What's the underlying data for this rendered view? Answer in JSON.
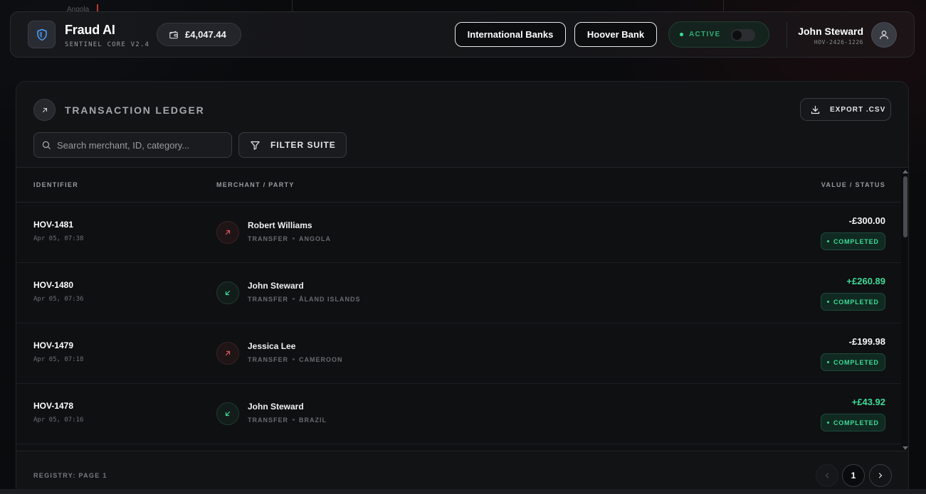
{
  "background": {
    "faint_label": "Angola"
  },
  "header": {
    "app_title": "Fraud AI",
    "app_subtitle": "SENTINEL CORE V2.4",
    "balance": "£4,047.44",
    "buttons": [
      "International Banks",
      "Hoover Bank"
    ],
    "status": "ACTIVE",
    "user_name": "John Steward",
    "user_id": "HOV-2426-1226"
  },
  "ledger": {
    "title": "TRANSACTION LEDGER",
    "export_label": "EXPORT .CSV",
    "search_placeholder": "Search merchant, ID, category...",
    "filter_label": "FILTER SUITE",
    "columns": {
      "identifier": "IDENTIFIER",
      "party": "MERCHANT / PARTY",
      "value": "VALUE / STATUS"
    },
    "rows": [
      {
        "id": "HOV-1481",
        "time": "Apr 05, 07:38",
        "party": "Robert Williams",
        "type": "TRANSFER",
        "location": "ANGOLA",
        "amount": "-£300.00",
        "direction": "out",
        "status": "COMPLETED"
      },
      {
        "id": "HOV-1480",
        "time": "Apr 05, 07:36",
        "party": "John Steward",
        "type": "TRANSFER",
        "location": "ÅLAND ISLANDS",
        "amount": "+£260.89",
        "direction": "in",
        "status": "COMPLETED"
      },
      {
        "id": "HOV-1479",
        "time": "Apr 05, 07:18",
        "party": "Jessica Lee",
        "type": "TRANSFER",
        "location": "CAMEROON",
        "amount": "-£199.98",
        "direction": "out",
        "status": "COMPLETED"
      },
      {
        "id": "HOV-1478",
        "time": "Apr 05, 07:16",
        "party": "John Steward",
        "type": "TRANSFER",
        "location": "BRAZIL",
        "amount": "+£43.92",
        "direction": "in",
        "status": "COMPLETED"
      }
    ],
    "footer_label": "REGISTRY: PAGE 1",
    "current_page": "1"
  },
  "colors": {
    "positive": "#3ddc97",
    "negative_icon": "#e0575b",
    "accent_blue": "#4aa3ff"
  }
}
